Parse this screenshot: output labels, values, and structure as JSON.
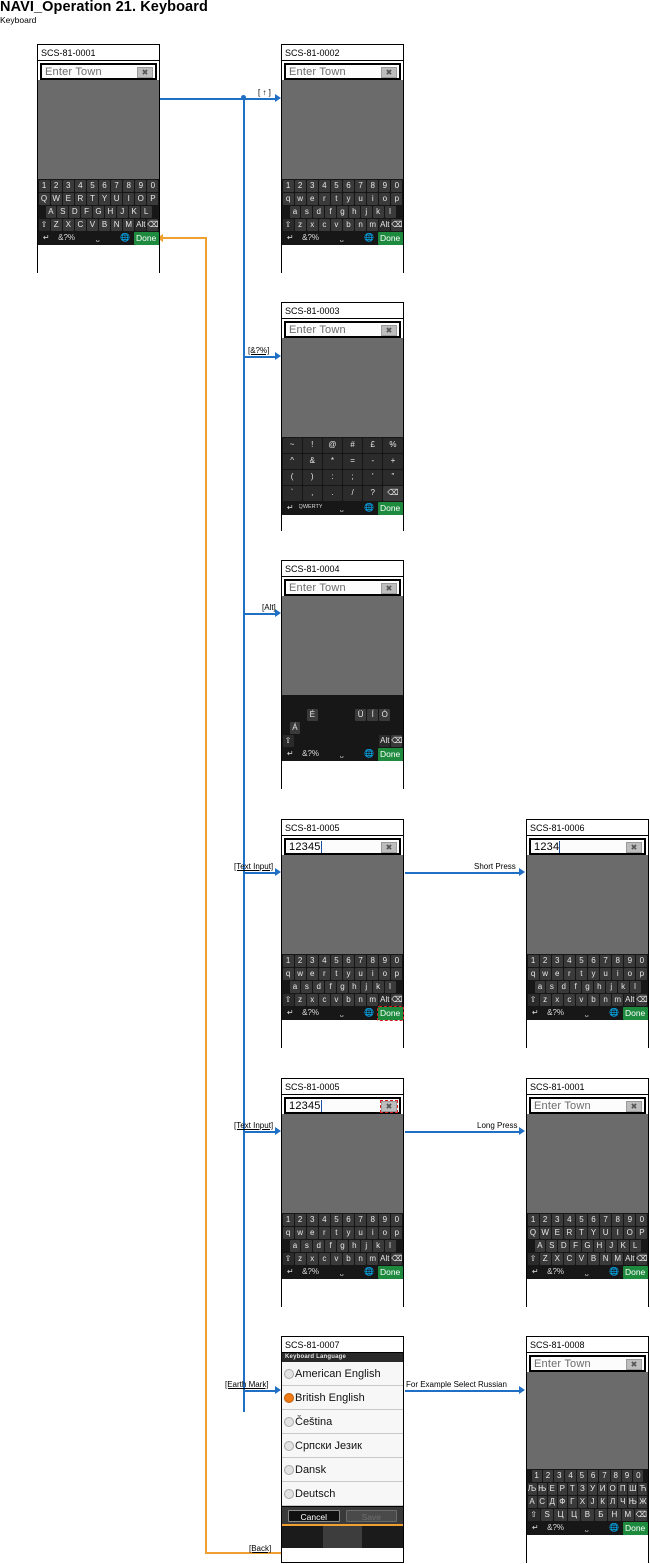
{
  "header": {
    "title": "NAVI_Operation   21. Keyboard",
    "subtitle": "Keyboard"
  },
  "common": {
    "placeholder": "Enter Town",
    "done_label": "Done",
    "clear_icon": "clear-x-icon",
    "back_icon": "return-arrow-icon",
    "symbol_label": "&?%",
    "qwerty_label": "QWERTY",
    "space_icon": "space-bar-icon",
    "globe_icon": "earth-mark-icon",
    "shift_icon": "shift-arrow-icon",
    "backspace_icon": "backspace-icon",
    "alt_label": "Alt"
  },
  "screens": {
    "s0001": {
      "id": "SCS-81-0001",
      "field_value": "",
      "rows": {
        "digits": [
          "1",
          "2",
          "3",
          "4",
          "5",
          "6",
          "7",
          "8",
          "9",
          "0"
        ],
        "r1": [
          "Q",
          "W",
          "E",
          "R",
          "T",
          "Y",
          "U",
          "I",
          "O",
          "P"
        ],
        "r2": [
          "A",
          "S",
          "D",
          "F",
          "G",
          "H",
          "J",
          "K",
          "L"
        ],
        "r3": [
          "Z",
          "X",
          "C",
          "V",
          "B",
          "N",
          "M"
        ]
      }
    },
    "s0002": {
      "id": "SCS-81-0002",
      "field_value": "",
      "rows": {
        "digits": [
          "1",
          "2",
          "3",
          "4",
          "5",
          "6",
          "7",
          "8",
          "9",
          "0"
        ],
        "r1": [
          "q",
          "w",
          "e",
          "r",
          "t",
          "y",
          "u",
          "i",
          "o",
          "p"
        ],
        "r2": [
          "a",
          "s",
          "d",
          "f",
          "g",
          "h",
          "j",
          "k",
          "l"
        ],
        "r3": [
          "z",
          "x",
          "c",
          "v",
          "b",
          "n",
          "m"
        ]
      }
    },
    "s0003": {
      "id": "SCS-81-0003",
      "field_value": "",
      "rows": {
        "r1": [
          "~",
          "!",
          "@",
          "#",
          "£",
          "%"
        ],
        "r2": [
          "^",
          "&",
          "*",
          "=",
          "-",
          "+"
        ],
        "r3": [
          "(",
          ")",
          ":",
          ";",
          "'",
          "\""
        ],
        "r4": [
          "`",
          ",",
          ".",
          "/",
          "?"
        ]
      }
    },
    "s0004": {
      "id": "SCS-81-0004",
      "field_value": "",
      "rows": {
        "r1": [
          "",
          "",
          "",
          "",
          "",
          "",
          "",
          "",
          "",
          ""
        ],
        "r2": [
          "",
          "",
          "É",
          "",
          "",
          "",
          "Ü",
          "Í",
          "Ó",
          ""
        ],
        "r3": [
          "Á",
          "",
          "",
          "",
          "",
          "",
          "",
          "",
          "",
          ""
        ],
        "r4": [
          "",
          "",
          "",
          "",
          "",
          "",
          "",
          "",
          ""
        ]
      }
    },
    "s0005a": {
      "id": "SCS-81-0005",
      "field_value": "12345",
      "highlight": "done-key"
    },
    "s0006": {
      "id": "SCS-81-0006",
      "field_value": "1234"
    },
    "s0005b": {
      "id": "SCS-81-0005",
      "field_value": "12345",
      "highlight": "clear-button"
    },
    "s0001b": {
      "id": "SCS-81-0001",
      "field_value": ""
    },
    "s0007": {
      "id": "SCS-81-0007",
      "list_title": "Keyboard Language",
      "items": [
        {
          "label": "American English",
          "selected": false
        },
        {
          "label": "British English",
          "selected": true
        },
        {
          "label": "Čeština",
          "selected": false
        },
        {
          "label": "Српски Језик",
          "selected": false
        },
        {
          "label": "Dansk",
          "selected": false
        },
        {
          "label": "Deutsch",
          "selected": false
        }
      ],
      "cancel_label": "Cancel",
      "save_label": "Save"
    },
    "s0008": {
      "id": "SCS-81-0008",
      "field_value": "",
      "rows": {
        "digits": [
          "1",
          "2",
          "3",
          "4",
          "5",
          "6",
          "7",
          "8",
          "9",
          "0"
        ],
        "r1": [
          "Љ",
          "Њ",
          "Е",
          "Р",
          "Т",
          "З",
          "У",
          "И",
          "О",
          "П",
          "Ш",
          "Ћ"
        ],
        "r2": [
          "А",
          "С",
          "Д",
          "Ф",
          "Г",
          "Х",
          "Ј",
          "К",
          "Л",
          "Ч",
          "Њ",
          "Ж"
        ],
        "r3": [
          "S",
          "Ц",
          "Ц",
          "В",
          "Б",
          "Н",
          "М"
        ]
      }
    }
  },
  "connectors": {
    "shift": "[ ↑ ]",
    "symbol": "[&?%]",
    "alt": "[Alt]",
    "text_input_1": "[Text Input]",
    "text_input_2": "[Text Input]",
    "earth_mark": "[Earth Mark]",
    "back": "[Back]",
    "short_press": "Short Press",
    "long_press": "Long Press",
    "select_russian": "For Example Select Russian"
  }
}
